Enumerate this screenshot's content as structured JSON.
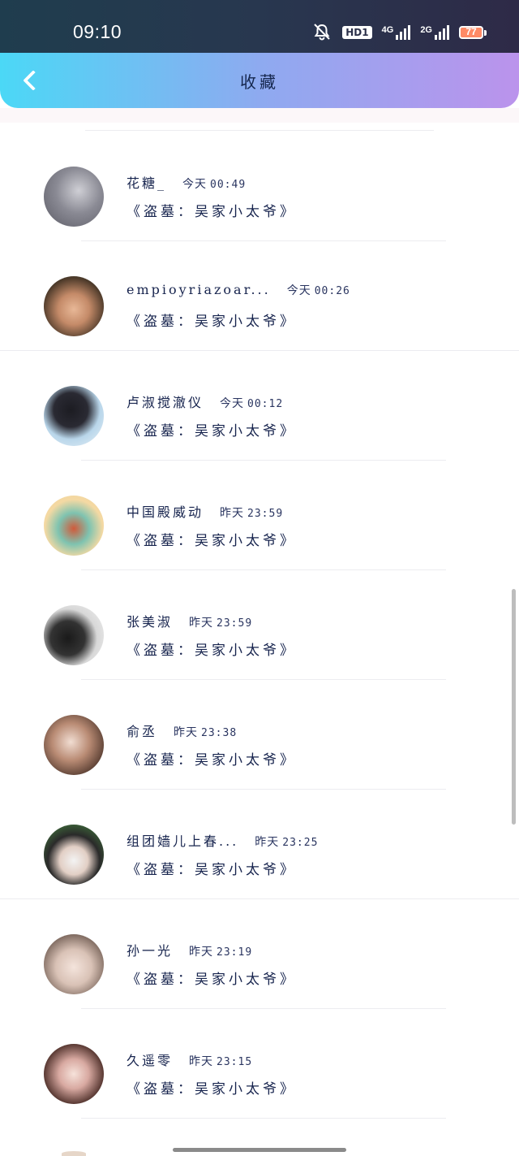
{
  "status_bar": {
    "time": "09:10",
    "hd_label": "HD1",
    "net1_label": "4G",
    "net2_label": "2G",
    "battery_level": "77",
    "battery_color": "#ff8a66"
  },
  "header": {
    "title": "收藏",
    "back_icon": "chevron-left-icon",
    "gradient_start": "#4bd8f6",
    "gradient_end": "#bb93ec"
  },
  "items": [
    {
      "name": "花糖_",
      "day": "今天",
      "time": "00:49",
      "message": "《盗墓：吴家小太爷》"
    },
    {
      "name": "empioyriazoar...",
      "day": "今天",
      "time": "00:26",
      "message": "《盗墓：吴家小太爷》"
    },
    {
      "name": "卢淑搅澈仪",
      "day": "今天",
      "time": "00:12",
      "message": "《盗墓：吴家小太爷》"
    },
    {
      "name": "中国殿威动",
      "day": "昨天",
      "time": "23:59",
      "message": "《盗墓：吴家小太爷》"
    },
    {
      "name": "张美淑",
      "day": "昨天",
      "time": "23:59",
      "message": "《盗墓：吴家小太爷》"
    },
    {
      "name": "俞丞",
      "day": "昨天",
      "time": "23:38",
      "message": "《盗墓：吴家小太爷》"
    },
    {
      "name": "组团嫱儿上春...",
      "day": "昨天",
      "time": "23:25",
      "message": "《盗墓：吴家小太爷》"
    },
    {
      "name": "孙一光",
      "day": "昨天",
      "time": "23:19",
      "message": "《盗墓：吴家小太爷》"
    },
    {
      "name": "久遥零",
      "day": "昨天",
      "time": "23:15",
      "message": "《盗墓：吴家小太爷》"
    }
  ]
}
